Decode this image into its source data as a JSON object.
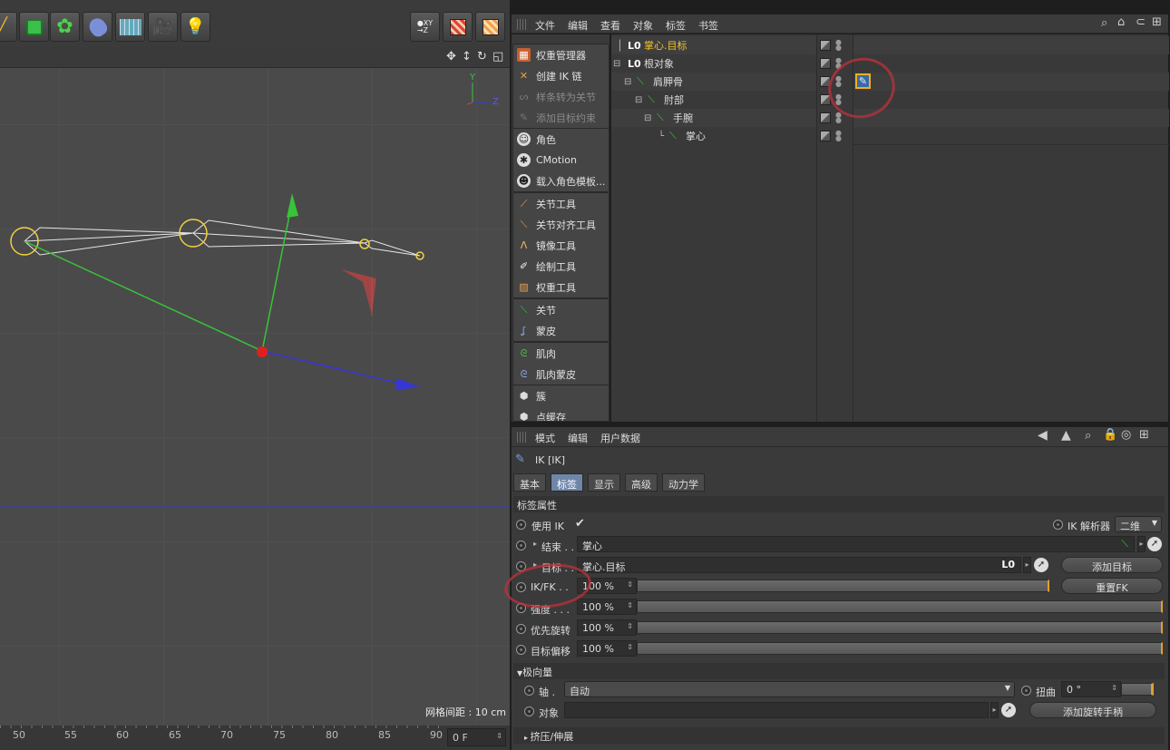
{
  "viewport": {
    "grid_label": "网格间距 : 10 cm",
    "axis_y": "Y",
    "axis_z": "Z"
  },
  "ruler": {
    "ticks": [
      "50",
      "55",
      "60",
      "65",
      "70",
      "75",
      "80",
      "85",
      "90"
    ],
    "frame_value": "0 F"
  },
  "object_manager": {
    "menu": [
      "文件",
      "编辑",
      "查看",
      "对象",
      "标签",
      "书签"
    ],
    "tree": [
      {
        "name": "掌心.目标",
        "depth": 0,
        "type": "null",
        "highlight": true
      },
      {
        "name": "根对象",
        "depth": 0,
        "type": "null",
        "highlight": false
      },
      {
        "name": "肩胛骨",
        "depth": 1,
        "type": "joint",
        "highlight": false
      },
      {
        "name": "肘部",
        "depth": 2,
        "type": "joint",
        "highlight": false
      },
      {
        "name": "手腕",
        "depth": 3,
        "type": "joint",
        "highlight": false
      },
      {
        "name": "掌心",
        "depth": 4,
        "type": "joint",
        "highlight": false
      }
    ]
  },
  "palette": {
    "groups": [
      [
        {
          "label": "权重管理器",
          "icon": "weight-manager-icon",
          "disabled": false
        },
        {
          "label": "创建 IK 链",
          "icon": "ik-chain-icon",
          "disabled": false
        },
        {
          "label": "样条转为关节",
          "icon": "spline-to-joint-icon",
          "disabled": true
        },
        {
          "label": "添加目标约束",
          "icon": "constraint-icon",
          "disabled": true
        }
      ],
      [
        {
          "label": "角色",
          "icon": "character-icon",
          "disabled": false
        },
        {
          "label": "CMotion",
          "icon": "cmotion-icon",
          "disabled": false
        },
        {
          "label": "载入角色模板...",
          "icon": "template-icon",
          "disabled": false
        }
      ],
      [
        {
          "label": "关节工具",
          "icon": "joint-tool-icon",
          "disabled": false
        },
        {
          "label": "关节对齐工具",
          "icon": "joint-align-icon",
          "disabled": false
        },
        {
          "label": "镜像工具",
          "icon": "mirror-tool-icon",
          "disabled": false
        },
        {
          "label": "绘制工具",
          "icon": "paint-tool-icon",
          "disabled": false
        },
        {
          "label": "权重工具",
          "icon": "weight-tool-icon",
          "disabled": false
        }
      ],
      [
        {
          "label": "关节",
          "icon": "joint-icon",
          "disabled": false
        },
        {
          "label": "蒙皮",
          "icon": "skin-icon",
          "disabled": false
        }
      ],
      [
        {
          "label": "肌肉",
          "icon": "muscle-icon",
          "disabled": false
        },
        {
          "label": "肌肉蒙皮",
          "icon": "muscle-skin-icon",
          "disabled": false
        }
      ],
      [
        {
          "label": "簇",
          "icon": "cluster-icon",
          "disabled": false
        },
        {
          "label": "点缓存",
          "icon": "point-cache-icon",
          "disabled": false
        }
      ]
    ]
  },
  "attributes": {
    "menu": [
      "模式",
      "编辑",
      "用户数据"
    ],
    "title": "IK [IK]",
    "tabs": [
      "基本",
      "标签",
      "显示",
      "高级",
      "动力学"
    ],
    "active_tab": "标签",
    "section_tag": "标签属性",
    "use_ik_label": "使用 IK",
    "use_ik_check": "✔",
    "solver_label": "IK 解析器",
    "solver_value": "二维",
    "end_label": "结束 . .",
    "end_value": "掌心",
    "target_label": "目标 . .",
    "target_value": "掌心.目标",
    "add_target": "添加目标",
    "reset_fk": "重置FK",
    "sliders": [
      {
        "label": "IK/FK . .",
        "value": "100 %"
      },
      {
        "label": "强度 . . .",
        "value": "100 %"
      },
      {
        "label": "优先旋转",
        "value": "100 %"
      },
      {
        "label": "目标偏移",
        "value": "100 %"
      }
    ],
    "section_pole": "极向量",
    "axis_label": "轴 .",
    "axis_value": "自动",
    "twist_label": "扭曲",
    "twist_value": "0 °",
    "object_label": "对象",
    "add_pole": "添加旋转手柄",
    "section_squash": "挤压/伸展"
  }
}
